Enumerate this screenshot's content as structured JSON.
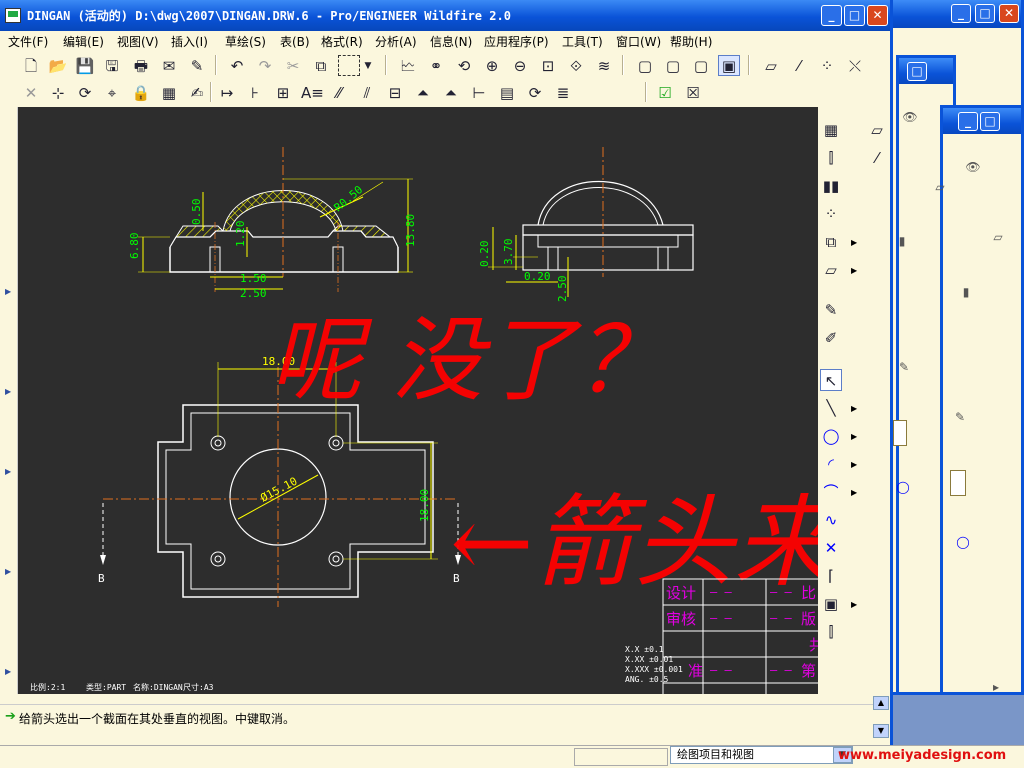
{
  "window": {
    "title": "DINGAN (活动的) D:\\dwg\\2007\\DINGAN.DRW.6 - Pro/ENGINEER Wildfire 2.0",
    "minimize": "_",
    "maximize": "□",
    "close": "✕"
  },
  "menu": [
    {
      "label": "文件(F)"
    },
    {
      "label": "编辑(E)"
    },
    {
      "label": "视图(V)"
    },
    {
      "label": "插入(I)"
    },
    {
      "label": "草绘(S)"
    },
    {
      "label": "表(B)"
    },
    {
      "label": "格式(R)"
    },
    {
      "label": "分析(A)"
    },
    {
      "label": "信息(N)"
    },
    {
      "label": "应用程序(P)"
    },
    {
      "label": "工具(T)"
    },
    {
      "label": "窗口(W)"
    },
    {
      "label": "帮助(H)"
    }
  ],
  "toolbar": {
    "counter_value": "0"
  },
  "drawing": {
    "dims": {
      "d050": "0.50",
      "r850": "R0.50",
      "d680": "6.80",
      "d1380": "13.80",
      "d120": "1.20",
      "d150": "1.50",
      "d250": "2.50",
      "d020a": "0.20",
      "d370": "3.70",
      "d020b": "0.20",
      "d250b": "2.50",
      "d1800": "18.00",
      "d1800v": "18.00",
      "dia": "Ø15.10"
    },
    "section_label_left": "B",
    "section_label_right": "B",
    "handwritten_line1": "呢 没了？",
    "handwritten_line2": "←箭头来了",
    "title_block": {
      "row1_label": "设计",
      "row1_dash": "– –",
      "row1_dash2": "– –",
      "row1_right": "比",
      "row2_label": "审核",
      "row2_dash": "– –",
      "row2_dash2": "– –",
      "row2_right": "版",
      "row3_right": "共",
      "row4_label": "准",
      "row4_dash": "– –",
      "row4_dash2": "– –",
      "row4_right": "第"
    },
    "tolerances": [
      "X.X   ±0.1",
      "X.XX  ±0.01",
      "X.XXX ±0.001",
      "ANG.  ±0.5"
    ],
    "footer_scale": "比例:2:1",
    "footer_type": "类型:PART",
    "footer_name": "名称:DINGAN",
    "footer_size": "尺寸:A3"
  },
  "message": {
    "text": "给箭头选出一个截面在其处垂直的视图。中键取消。"
  },
  "status": {
    "filter_value": "绘图项目和视图",
    "watermark": "www.meiyadesign.com"
  },
  "colors": {
    "titlebar": "#0a53d8",
    "canvas": "#2d2d2d",
    "dimension": "#ffff00",
    "dim_text": "#00ff00",
    "annotation": "#ff0000",
    "titleblock": "#e000e0"
  }
}
